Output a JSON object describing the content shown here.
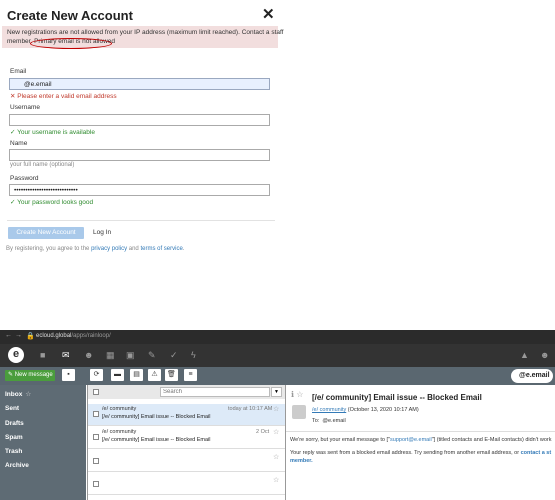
{
  "modal": {
    "title": "Create New Account",
    "close_glyph": "✕",
    "alert_line1": "New registrations are not allowed from your IP address (maximum limit reached). Contact a staff",
    "alert_line2": "member. Primary email is not allowed",
    "email_label": "Email",
    "email_value": "@e.email",
    "email_error": "✕ Please enter a valid email address",
    "username_label": "Username",
    "username_ok": "✓ Your username is available",
    "name_label": "Name",
    "name_hint": "your full name (optional)",
    "password_label": "Password",
    "password_value": "••••••••••••••••••••••••••••",
    "password_ok": "✓ Your password looks good",
    "create_button": "Create New Account",
    "login_link": "Log In",
    "terms_prefix": "By registering, you agree to the ",
    "privacy_link": "privacy policy",
    "terms_mid": " and ",
    "tos_link": "terms of service",
    "terms_suffix": "."
  },
  "browser": {
    "url_domain": "ecloud.global",
    "url_path": "/apps/rainloop/",
    "user_badge": "@e.email",
    "new_message": "✎ New message",
    "folders": [
      "Inbox",
      "Sent",
      "Drafts",
      "Spam",
      "Trash",
      "Archive"
    ],
    "search_placeholder": "Search",
    "messages": [
      {
        "from": "/e/ community",
        "subject": "[/e/ community] Email issue -- Blocked Email",
        "date": "today at 10:17 AM"
      },
      {
        "from": "/e/ community",
        "subject": "[/e/ community] Email issue -- Blocked Email",
        "date": "2 Oct"
      }
    ],
    "reader": {
      "title": "[/e/ community] Email issue -- Blocked Email",
      "from_name": "/e/ community",
      "from_date": "(October 13, 2020 10:17 AM)",
      "to_label": "To:",
      "to_value": "@e.email",
      "body1_pre": "We're sorry, but your email message to [\"",
      "body1_link": "support@e.email",
      "body1_post": "\"] (titled contacts and E-Mail contacts) didn't work",
      "body2_pre": "Your reply was sent from a blocked email address. Try sending from another email address, or ",
      "body2_bold": "contact a st",
      "body3": "member."
    }
  }
}
